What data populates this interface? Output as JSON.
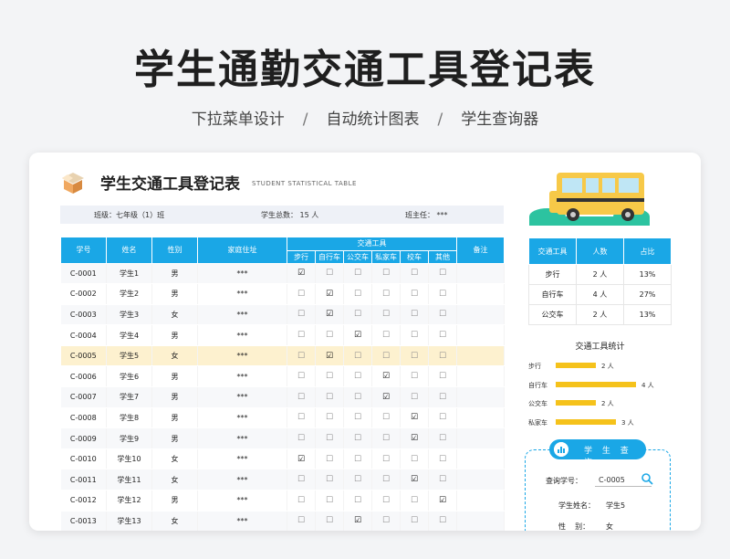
{
  "hero": {
    "title": "学生通勤交通工具登记表",
    "features": [
      "下拉菜单设计",
      "自动统计图表",
      "学生查询器"
    ],
    "separator": "/"
  },
  "sheet": {
    "icon": "open-box-icon",
    "title": "学生交通工具登记表",
    "subtitle": "STUDENT STATISTICAL TABLE",
    "class_info": "班级：七年级（1）班",
    "total_info": "学生总数：  15  人",
    "teacher_info": "班主任：  ***"
  },
  "table": {
    "headers": {
      "id": "学号",
      "name": "姓名",
      "gender": "性别",
      "address": "家庭住址",
      "transport_group": "交通工具",
      "note": "备注"
    },
    "transport_modes": [
      "步行",
      "自行车",
      "公交车",
      "私家车",
      "校车",
      "其他"
    ],
    "rows": [
      {
        "id": "C-0001",
        "name": "学生1",
        "gender": "男",
        "address": "***",
        "checks": [
          1,
          0,
          0,
          0,
          0,
          0
        ]
      },
      {
        "id": "C-0002",
        "name": "学生2",
        "gender": "男",
        "address": "***",
        "checks": [
          0,
          1,
          0,
          0,
          0,
          0
        ]
      },
      {
        "id": "C-0003",
        "name": "学生3",
        "gender": "女",
        "address": "***",
        "checks": [
          0,
          1,
          0,
          0,
          0,
          0
        ]
      },
      {
        "id": "C-0004",
        "name": "学生4",
        "gender": "男",
        "address": "***",
        "checks": [
          0,
          0,
          1,
          0,
          0,
          0
        ]
      },
      {
        "id": "C-0005",
        "name": "学生5",
        "gender": "女",
        "address": "***",
        "checks": [
          0,
          1,
          0,
          0,
          0,
          0
        ],
        "highlight": true
      },
      {
        "id": "C-0006",
        "name": "学生6",
        "gender": "男",
        "address": "***",
        "checks": [
          0,
          0,
          0,
          1,
          0,
          0
        ]
      },
      {
        "id": "C-0007",
        "name": "学生7",
        "gender": "男",
        "address": "***",
        "checks": [
          0,
          0,
          0,
          1,
          0,
          0
        ]
      },
      {
        "id": "C-0008",
        "name": "学生8",
        "gender": "男",
        "address": "***",
        "checks": [
          0,
          0,
          0,
          0,
          1,
          0
        ]
      },
      {
        "id": "C-0009",
        "name": "学生9",
        "gender": "男",
        "address": "***",
        "checks": [
          0,
          0,
          0,
          0,
          1,
          0
        ]
      },
      {
        "id": "C-0010",
        "name": "学生10",
        "gender": "女",
        "address": "***",
        "checks": [
          1,
          0,
          0,
          0,
          0,
          0
        ]
      },
      {
        "id": "C-0011",
        "name": "学生11",
        "gender": "女",
        "address": "***",
        "checks": [
          0,
          0,
          0,
          0,
          1,
          0
        ]
      },
      {
        "id": "C-0012",
        "name": "学生12",
        "gender": "男",
        "address": "***",
        "checks": [
          0,
          0,
          0,
          0,
          0,
          1
        ]
      },
      {
        "id": "C-0013",
        "name": "学生13",
        "gender": "女",
        "address": "***",
        "checks": [
          0,
          0,
          1,
          0,
          0,
          0
        ]
      }
    ],
    "checked_glyph": "☑",
    "unchecked_glyph": "☐"
  },
  "illustration": {
    "icon": "school-bus-icon",
    "bus_color": "#f7c948",
    "grass_color": "#2cc3a0"
  },
  "stats": {
    "headers": [
      "交通工具",
      "人数",
      "占比"
    ],
    "rows": [
      {
        "mode": "步行",
        "count": "2 人",
        "pct": "13%"
      },
      {
        "mode": "自行车",
        "count": "4 人",
        "pct": "27%"
      },
      {
        "mode": "公交车",
        "count": "2 人",
        "pct": "13%"
      }
    ]
  },
  "chart_data": {
    "type": "bar",
    "title": "交通工具统计",
    "categories": [
      "步行",
      "自行车",
      "公交车",
      "私家车"
    ],
    "values": [
      2,
      4,
      2,
      3
    ],
    "value_labels": [
      "2 人",
      "4 人",
      "2 人",
      "3 人"
    ],
    "orientation": "horizontal",
    "bar_color": "#f5c21b"
  },
  "query": {
    "title": "学 生 查 询",
    "icon": "bar-chart-icon",
    "id_label": "查询学号：",
    "id_value": "C-0005",
    "search_icon": "search-icon",
    "name_label": "学生姓名：",
    "name_value": "学生5",
    "gender_label": "性    别：",
    "gender_value": "女"
  },
  "colors": {
    "accent": "#1aa7e6",
    "highlight_row": "#fdf1cf",
    "bar": "#f5c21b"
  }
}
